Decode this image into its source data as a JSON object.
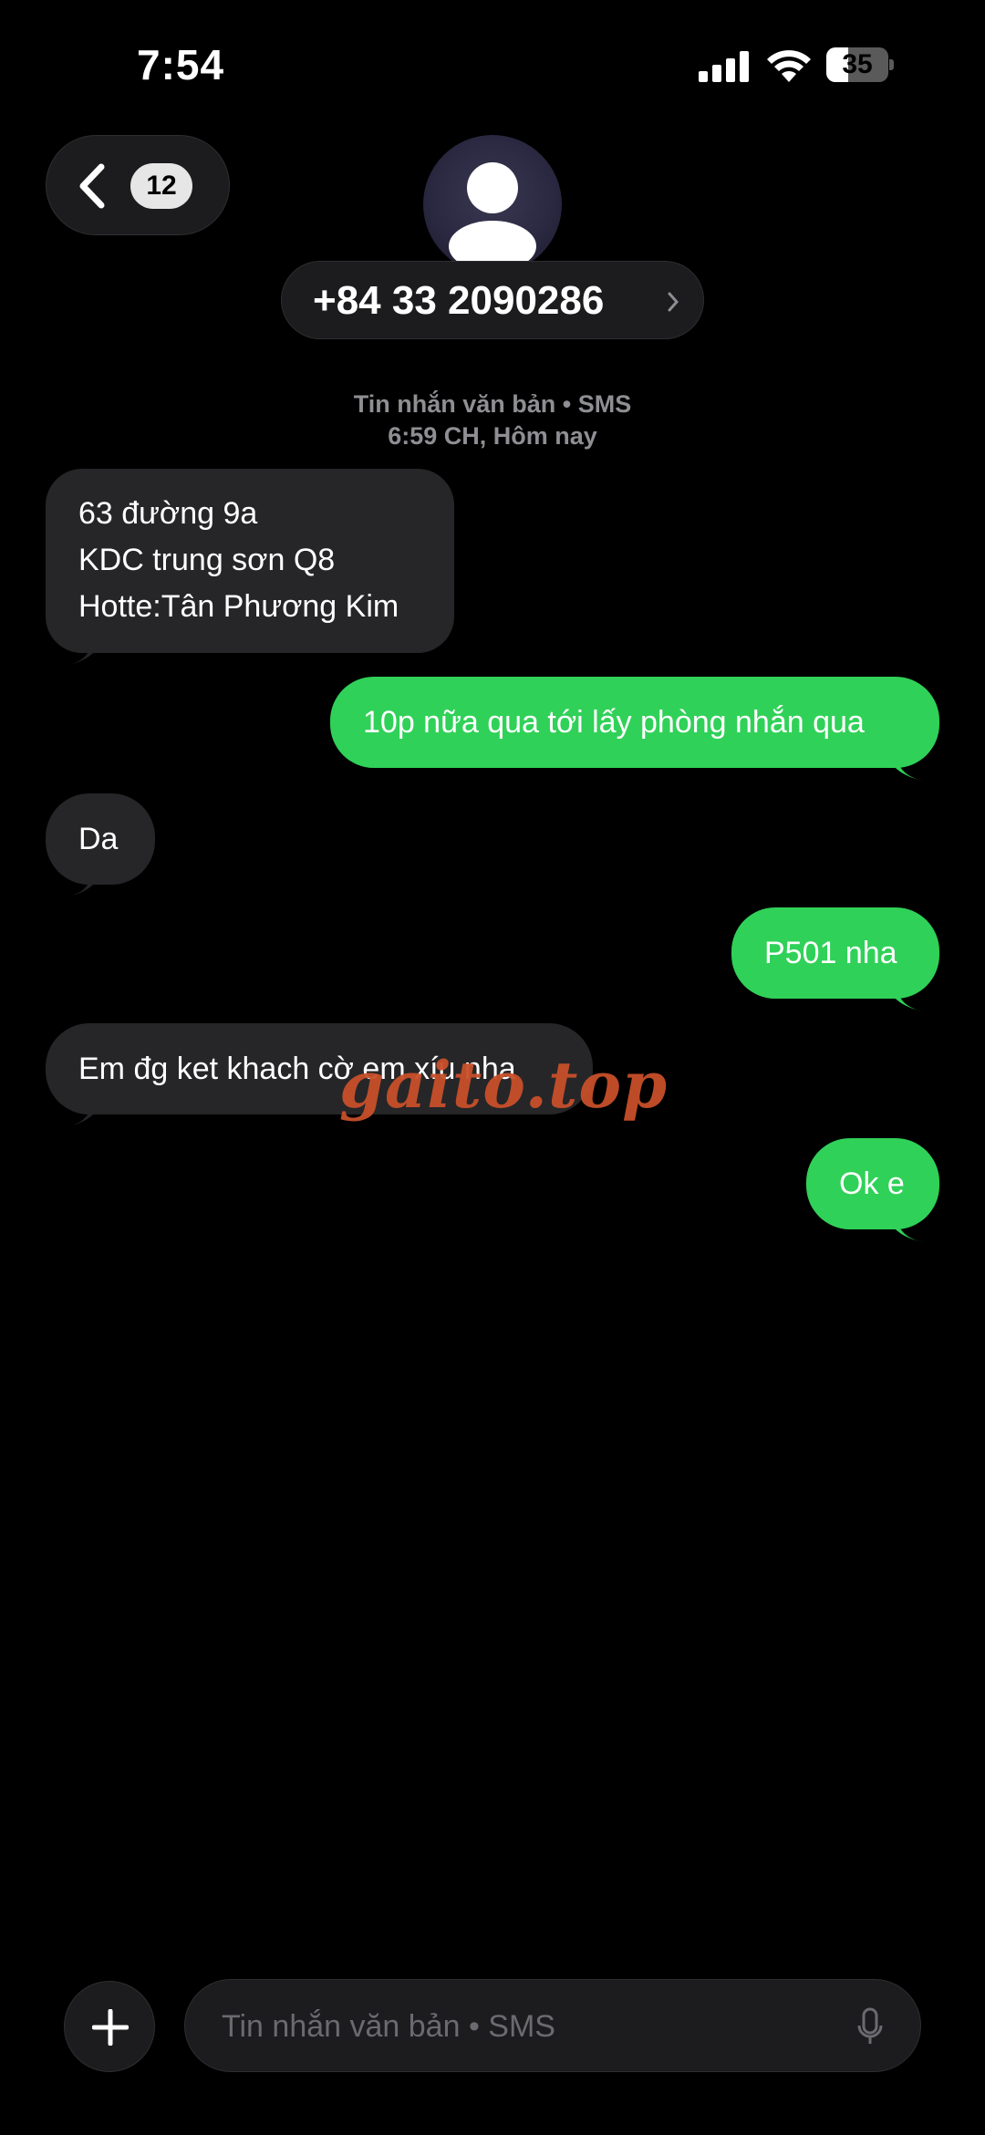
{
  "status_bar": {
    "time": "7:54",
    "battery_level": "35",
    "battery_fraction": 0.35
  },
  "header": {
    "back_count": "12",
    "contact": "+84 33 2090286"
  },
  "thread": {
    "service_label": "Tin nhắn văn bản • SMS",
    "timestamp": "6:59 CH, Hôm nay"
  },
  "messages": [
    {
      "direction": "incoming",
      "lines": [
        "63 đường 9a",
        "KDC trung sơn Q8",
        "Hotte:Tân Phương Kim"
      ]
    },
    {
      "direction": "outgoing",
      "text": "10p nữa qua tới lấy phòng nhắn qua"
    },
    {
      "direction": "incoming",
      "text": "Da"
    },
    {
      "direction": "outgoing",
      "text": "P501 nha"
    },
    {
      "direction": "incoming",
      "text": "Em đg ket khach cờ em xíu nha"
    },
    {
      "direction": "outgoing",
      "text": "Ok e"
    }
  ],
  "watermark": "gaito.top",
  "composer": {
    "placeholder": "Tin nhắn văn bản • SMS"
  },
  "colors": {
    "background": "#000000",
    "incoming_bubble": "#262628",
    "outgoing_bubble": "#30d158",
    "secondary_text": "#8e8e93",
    "watermark": "#c8502a"
  },
  "icons": [
    "back-chevron-icon",
    "person-icon",
    "chevron-right-icon",
    "plus-icon",
    "microphone-icon",
    "cellular-signal-icon",
    "wifi-icon",
    "battery-icon"
  ]
}
